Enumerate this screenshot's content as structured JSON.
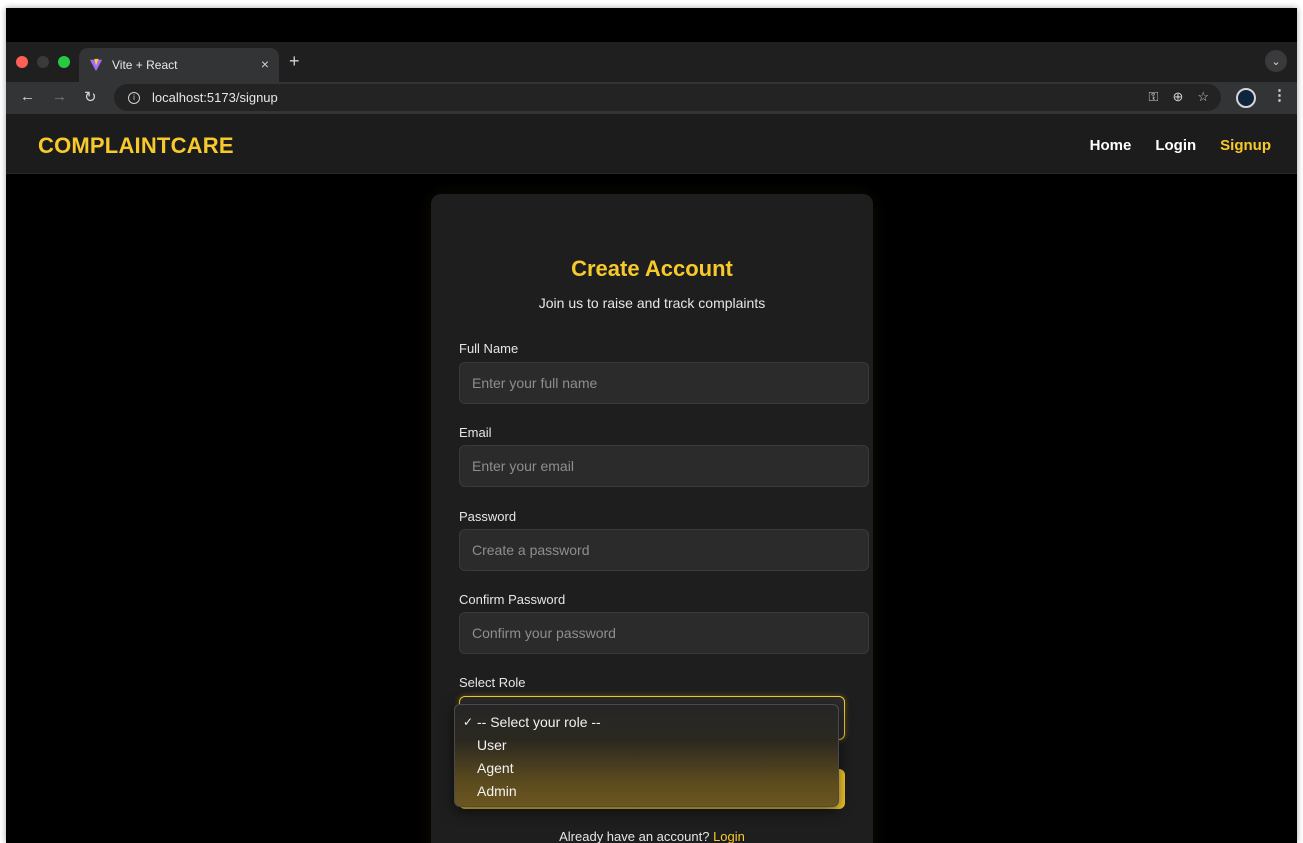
{
  "browser": {
    "tab_title": "Vite + React",
    "tab_close": "×",
    "new_tab": "+",
    "tab_menu": "⌄",
    "url": "localhost:5173/signup",
    "traffic_lights": [
      "#ff5f57",
      "#3a3a3c",
      "#28c840"
    ],
    "icons": [
      "key-icon",
      "zoom-icon",
      "star-icon",
      "profile-avatar",
      "menu-icon"
    ]
  },
  "header": {
    "brand": "COMPLAINTCARE",
    "nav": [
      {
        "label": "Home",
        "active": false
      },
      {
        "label": "Login",
        "active": false
      },
      {
        "label": "Signup",
        "active": true
      }
    ]
  },
  "form": {
    "title": "Create Account",
    "subtitle": "Join us to raise and track complaints",
    "fields": [
      {
        "label": "Full Name",
        "placeholder": "Enter your full name",
        "value": ""
      },
      {
        "label": "Email",
        "placeholder": "Enter your email",
        "value": ""
      },
      {
        "label": "Password",
        "placeholder": "Create a password",
        "value": ""
      },
      {
        "label": "Confirm Password",
        "placeholder": "Confirm your password",
        "value": ""
      }
    ],
    "role_label": "Select Role",
    "role_options": [
      "-- Select your role --",
      "User",
      "Agent",
      "Admin"
    ],
    "role_selected": "-- Select your role --",
    "login_prompt": "Already have an account?",
    "login_link": "Login"
  },
  "colors": {
    "accent": "#f7c92b",
    "background": "#000000",
    "card": "#1e1e1e"
  }
}
